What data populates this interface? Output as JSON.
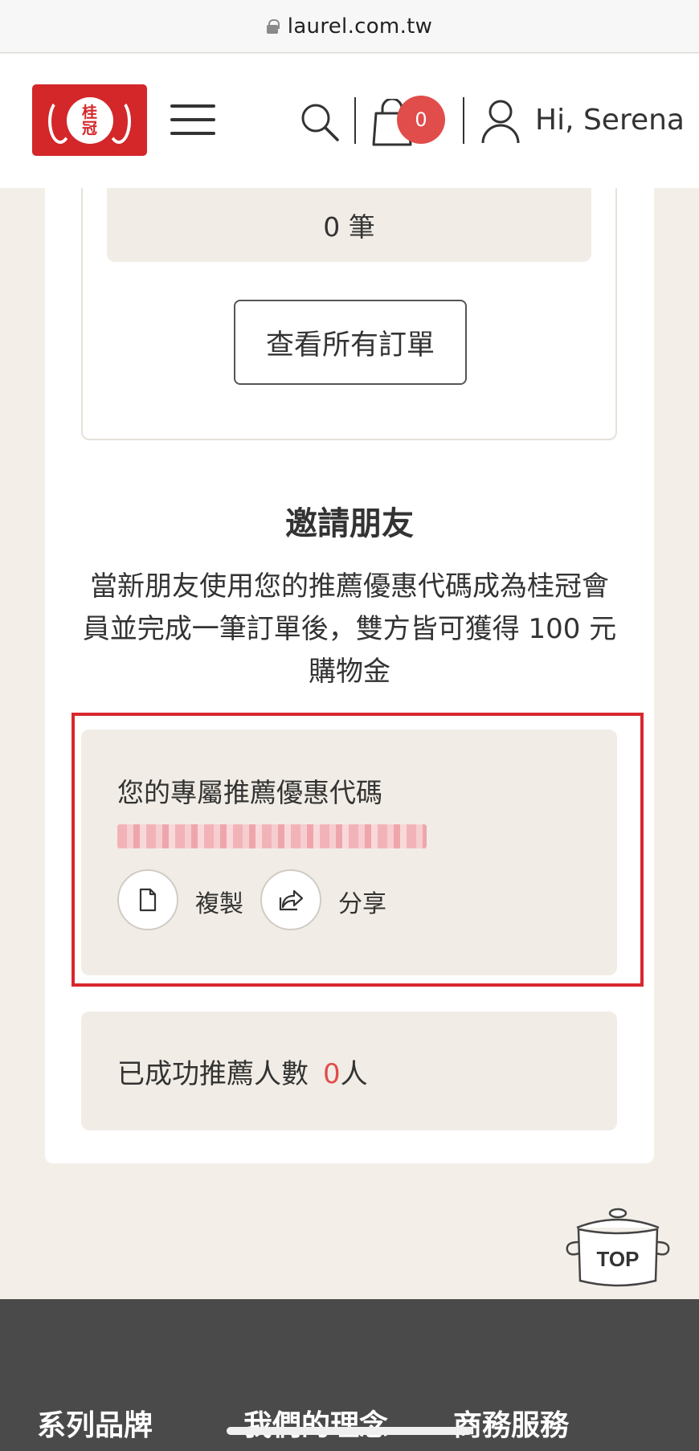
{
  "browser": {
    "url": "laurel.com.tw"
  },
  "header": {
    "logo_text": [
      "桂",
      "冠"
    ],
    "cart_count": "0",
    "greeting": "Hi, Serena"
  },
  "orders": {
    "count_text": "0 筆",
    "view_all_label": "查看所有訂單"
  },
  "invite": {
    "title": "邀請朋友",
    "description": "當新朋友使用您的推薦優惠代碼成為桂冠會員並完成一筆訂單後，雙方皆可獲得 100 元購物金",
    "code_label": "您的專屬推薦優惠代碼",
    "copy_label": "複製",
    "share_label": "分享",
    "referrals_label": "已成功推薦人數",
    "referrals_count": "0",
    "referrals_unit": "人"
  },
  "top_button": {
    "label": "TOP"
  },
  "footer": {
    "nav": [
      "系列品牌",
      "我們的理念",
      "商務服務"
    ]
  },
  "colors": {
    "brand_red": "#d3272a",
    "badge_red": "#e04d4b",
    "background": "#f3efe8",
    "footer_bg": "#4a4a4a"
  }
}
